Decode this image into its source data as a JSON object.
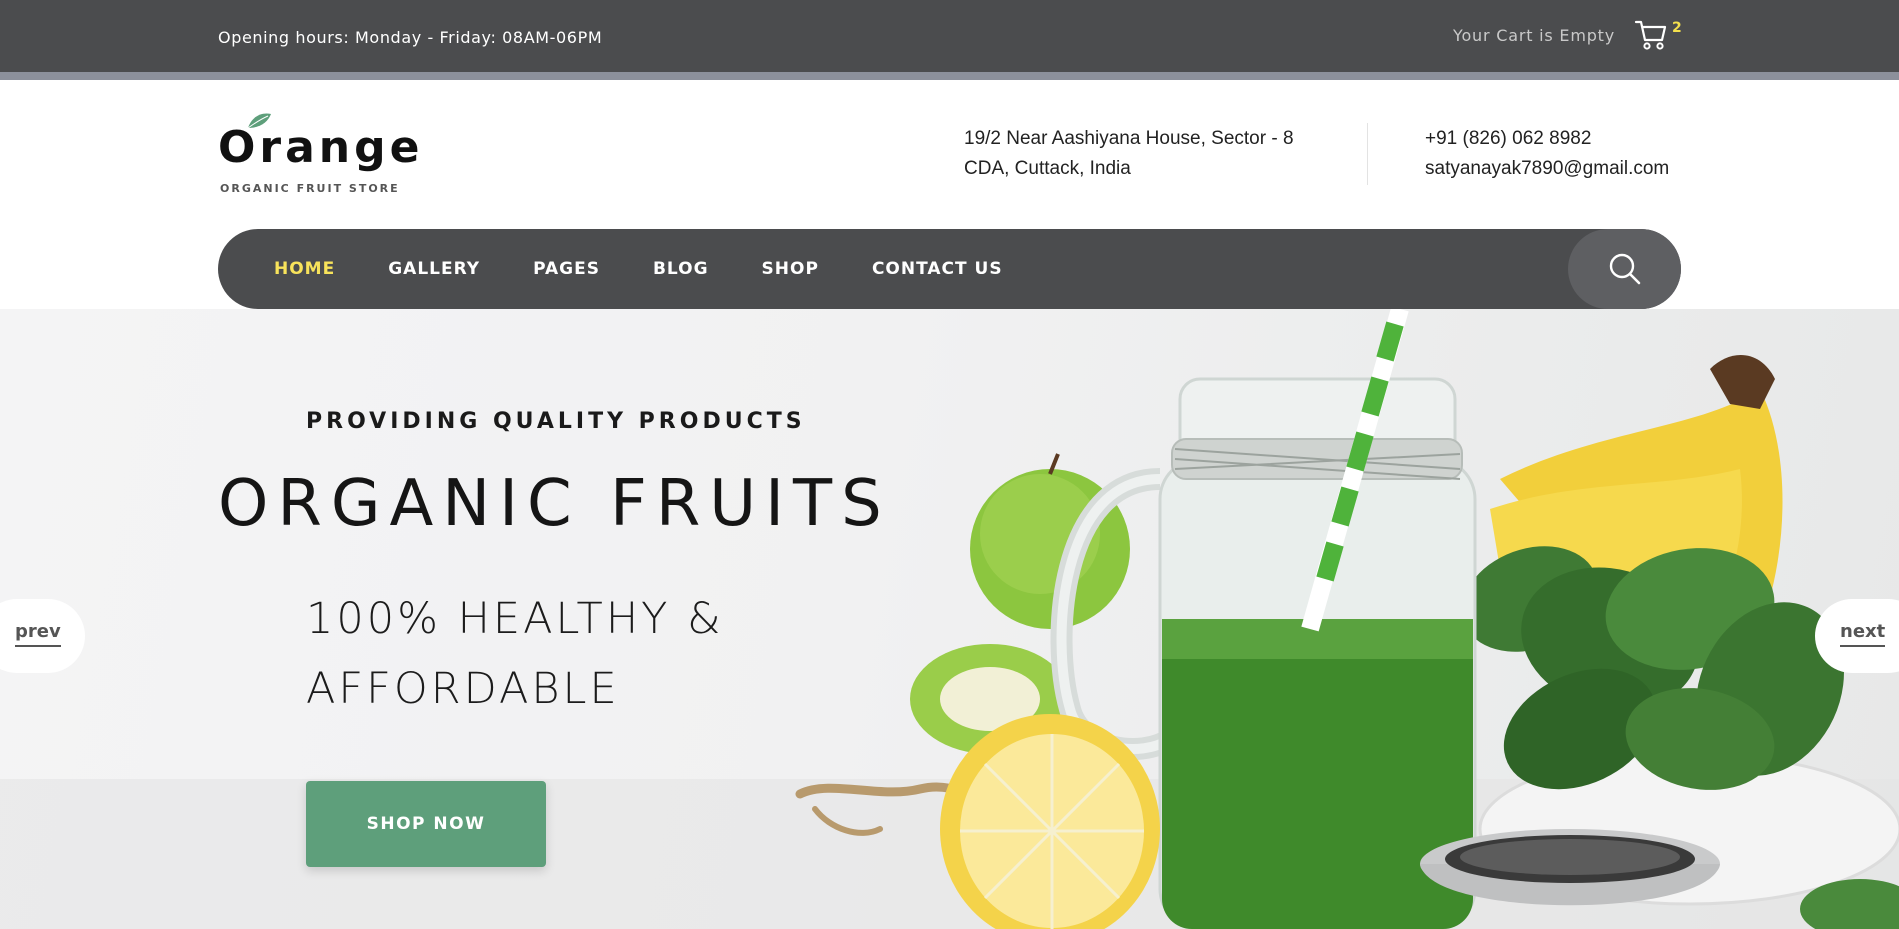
{
  "topbar": {
    "hours": "Opening hours: Monday - Friday: 08AM-06PM",
    "cart_text": "Your Cart is Empty",
    "cart_count": "2",
    "cart_icon": "shopping-cart-icon"
  },
  "brand": {
    "name": "Orange",
    "tagline": "ORGANIC FRUIT STORE",
    "leaf_color": "#5e9f7b"
  },
  "header": {
    "address_line1": "19/2 Near Aashiyana House, Sector - 8",
    "address_line2": "CDA, Cuttack, India",
    "phone": "+91 (826) 062 8982",
    "email": "satyanayak7890@gmail.com"
  },
  "nav": {
    "items": [
      {
        "label": "HOME",
        "active": true
      },
      {
        "label": "GALLERY",
        "active": false
      },
      {
        "label": "PAGES",
        "active": false
      },
      {
        "label": "BLOG",
        "active": false
      },
      {
        "label": "SHOP",
        "active": false
      },
      {
        "label": "CONTACT US",
        "active": false
      }
    ],
    "search_icon": "search-icon"
  },
  "hero": {
    "eyebrow": "PROVIDING QUALITY PRODUCTS",
    "headline": "ORGANIC FRUITS",
    "subhead_line1": "100% HEALTHY &",
    "subhead_line2": "AFFORDABLE",
    "cta": "SHOP NOW",
    "prev": "prev",
    "next": "next"
  },
  "colors": {
    "topbar": "#4b4c4e",
    "nav_active": "#f8e35b",
    "cta": "#5e9f7b",
    "cart_badge": "#f4e04d"
  }
}
